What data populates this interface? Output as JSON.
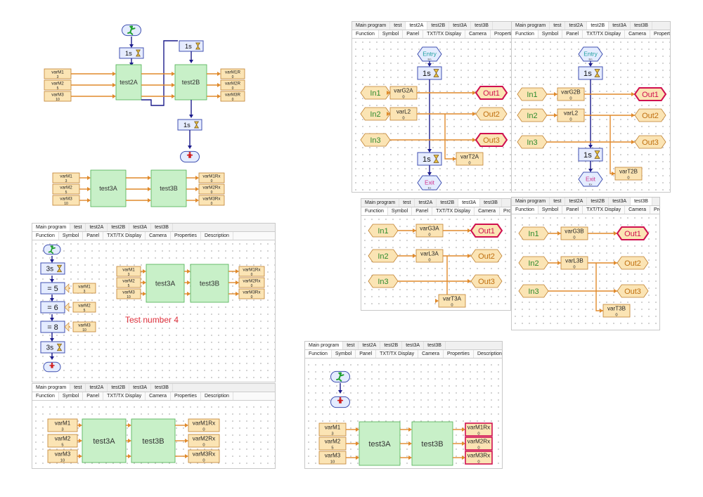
{
  "tabs": {
    "main": [
      "Main program",
      "test",
      "test2A",
      "test2B",
      "test3A",
      "test3B"
    ],
    "sub": [
      "Function",
      "Symbol",
      "Panel",
      "TXT/TX Display",
      "Camera",
      "Properties",
      "Description"
    ]
  },
  "timers": {
    "one_second": "1s",
    "three_seconds": "3s"
  },
  "top_program": {
    "inputs": [
      {
        "name": "varM1",
        "value": "3"
      },
      {
        "name": "varM2",
        "value": "5"
      },
      {
        "name": "varM3",
        "value": "10"
      }
    ],
    "outputs_a": [
      {
        "name": "varM1R",
        "value": "0"
      },
      {
        "name": "varM2R",
        "value": "0"
      },
      {
        "name": "varM3R",
        "value": "0"
      }
    ],
    "outputs_b": [
      {
        "name": "varM1Rx",
        "value": "0"
      },
      {
        "name": "varM2Rx",
        "value": "0"
      },
      {
        "name": "varM3Rx",
        "value": "0"
      }
    ],
    "blocks": {
      "b2a": "test2A",
      "b2b": "test2B",
      "b3a": "test3A",
      "b3b": "test3B"
    }
  },
  "subprograms": {
    "test2A": {
      "g": "varG2A",
      "gv": "0",
      "l": "varL2",
      "lv": "0",
      "t": "varT2A",
      "tv": "0"
    },
    "test2B": {
      "g": "varG2B",
      "gv": "0",
      "l": "varL2",
      "lv": "0",
      "t": "varT2B",
      "tv": "0"
    },
    "test3A": {
      "g": "varG3A",
      "gv": "0",
      "l": "varL3A",
      "lv": "0",
      "t": "varT3A",
      "tv": "0"
    },
    "test3B": {
      "g": "varG3B",
      "gv": "0",
      "l": "varL3B",
      "lv": "0",
      "t": "varT3B",
      "tv": "0"
    }
  },
  "ports": {
    "in1": "In1",
    "in2": "In2",
    "in3": "In3",
    "out1": "Out1",
    "out2": "Out2",
    "out3": "Out3",
    "in": "In",
    "ou": "Ou"
  },
  "entry": {
    "label": "Entry",
    "sub": "En"
  },
  "exit": {
    "label": "Exit",
    "sub": "Ex"
  },
  "assignments": [
    {
      "op": "=",
      "value": "5",
      "var": "varM1",
      "val": "3"
    },
    {
      "op": "=",
      "value": "6",
      "var": "varM2",
      "val": "5"
    },
    {
      "op": "=",
      "value": "8",
      "var": "varM3",
      "val": "10"
    }
  ],
  "caption": "Test number 4",
  "colors": {
    "wire": "#e08a2c",
    "flow": "#1c1c8c",
    "block": "#c8f0c8",
    "block_border": "#4caf50",
    "var_fill": "#fbe4b4",
    "var_border": "#c08030",
    "green_text": "#2e8b2e",
    "entry_text": "#20a0a0",
    "exit_text": "#d0308c",
    "out_highlight": "#d01050"
  },
  "icons": [
    "start-runner-icon",
    "stop-runner-icon",
    "hourglass-icon",
    "entry-icon",
    "exit-icon"
  ]
}
